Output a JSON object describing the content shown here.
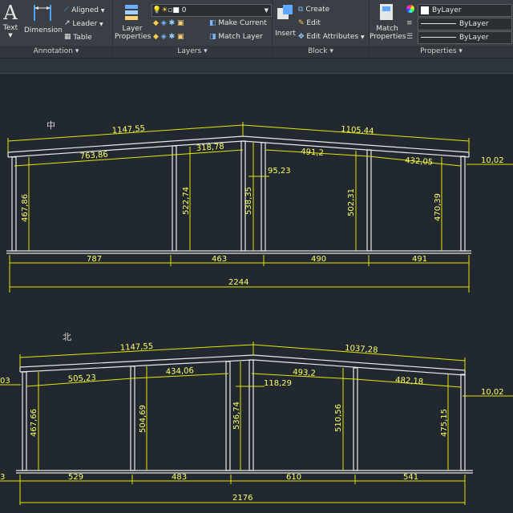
{
  "ribbon": {
    "annotation": {
      "panel_label": "Annotation",
      "text_label": "Text",
      "dimension_label": "Dimension",
      "aligned_label": "Aligned",
      "leader_label": "Leader",
      "table_label": "Table"
    },
    "layers": {
      "panel_label": "Layers",
      "layer_properties_label": "Layer Properties",
      "layer_combo_value": "0",
      "make_current_label": "Make Current",
      "match_layer_label": "Match Layer"
    },
    "block": {
      "panel_label": "Block",
      "insert_label": "Insert",
      "create_label": "Create",
      "edit_label": "Edit",
      "edit_attributes_label": "Edit Attributes"
    },
    "properties": {
      "panel_label": "Properties",
      "match_properties_label": "Match Properties",
      "color_value": "ByLayer",
      "linetype_value": "ByLayer",
      "lineweight_value": "ByLayer"
    }
  },
  "drawing": {
    "frame1": {
      "label": "中",
      "top_left": "1147,55",
      "top_right": "1105,44",
      "inner": [
        "763,86",
        "318,78",
        "491,2",
        "432,05"
      ],
      "side_right": "10,02",
      "small": "95,23",
      "heights": [
        "467,86",
        "522,74",
        "538,35",
        "502,31",
        "470,39"
      ],
      "bays": [
        "787",
        "463",
        "490",
        "491"
      ],
      "total": "2244"
    },
    "frame2": {
      "label": "北",
      "top_left": "1147,55",
      "top_right": "1037,28",
      "left_cut": "03",
      "inner": [
        "505,23",
        "434,06",
        "493,2",
        "482,18"
      ],
      "side_right": "10,02",
      "small": "118,29",
      "heights": [
        "467,66",
        "504,69",
        "536,74",
        "510,56",
        "475,15"
      ],
      "bays": [
        "529",
        "483",
        "610",
        "541"
      ],
      "left_bay_cut": "3",
      "total": "2176"
    }
  },
  "colors": {
    "dimension": "#ffff66",
    "structure": "#e8e8e8",
    "background": "#212830",
    "ribbon": "#3a3f46"
  }
}
